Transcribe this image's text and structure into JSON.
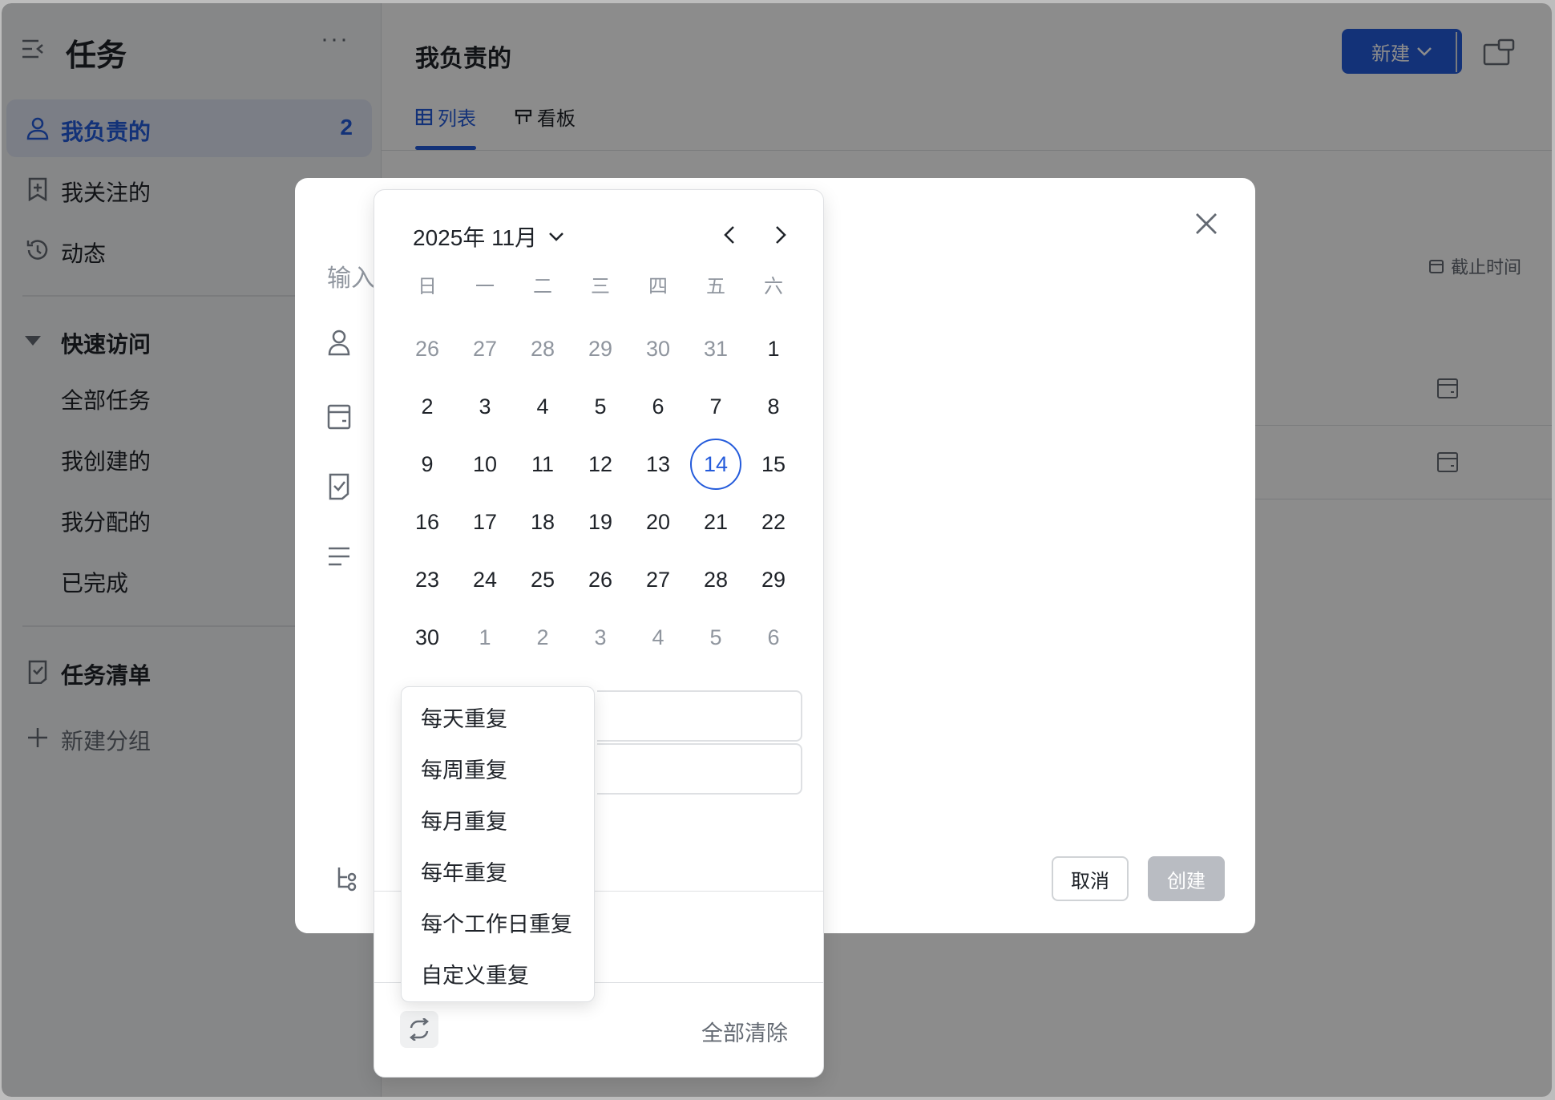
{
  "sidebar": {
    "title": "任务",
    "more": "···",
    "items": [
      {
        "label": "我负责的",
        "count": "2",
        "icon": "user-icon",
        "active": true
      },
      {
        "label": "我关注的",
        "icon": "bookmark-icon"
      },
      {
        "label": "动态",
        "icon": "history-icon"
      }
    ],
    "quick_access": {
      "label": "快速访问",
      "items": [
        "全部任务",
        "我创建的",
        "我分配的",
        "已完成"
      ]
    },
    "task_list": {
      "label": "任务清单",
      "icon": "checklist-icon"
    },
    "new_group": {
      "label": "新建分组",
      "icon": "plus-icon"
    }
  },
  "header": {
    "title": "我负责的",
    "new_button": "新建",
    "tabs": [
      {
        "label": "列表",
        "icon": "table-icon",
        "active": true
      },
      {
        "label": "看板",
        "icon": "kanban-icon"
      }
    ],
    "column_deadline": "截止时间"
  },
  "dialog": {
    "input_placeholder": "输入",
    "cancel": "取消",
    "create": "创建"
  },
  "datepicker": {
    "month_label": "2025年 11月",
    "weekdays": [
      "日",
      "一",
      "二",
      "三",
      "四",
      "五",
      "六"
    ],
    "weeks": [
      [
        {
          "d": "26",
          "o": true
        },
        {
          "d": "27",
          "o": true
        },
        {
          "d": "28",
          "o": true
        },
        {
          "d": "29",
          "o": true
        },
        {
          "d": "30",
          "o": true
        },
        {
          "d": "31",
          "o": true
        },
        {
          "d": "1"
        }
      ],
      [
        {
          "d": "2"
        },
        {
          "d": "3"
        },
        {
          "d": "4"
        },
        {
          "d": "5"
        },
        {
          "d": "6"
        },
        {
          "d": "7"
        },
        {
          "d": "8"
        }
      ],
      [
        {
          "d": "9"
        },
        {
          "d": "10"
        },
        {
          "d": "11"
        },
        {
          "d": "12"
        },
        {
          "d": "13"
        },
        {
          "d": "14",
          "today": true
        },
        {
          "d": "15"
        }
      ],
      [
        {
          "d": "16"
        },
        {
          "d": "17"
        },
        {
          "d": "18"
        },
        {
          "d": "19"
        },
        {
          "d": "20"
        },
        {
          "d": "21"
        },
        {
          "d": "22"
        }
      ],
      [
        {
          "d": "23"
        },
        {
          "d": "24"
        },
        {
          "d": "25"
        },
        {
          "d": "26"
        },
        {
          "d": "27"
        },
        {
          "d": "28"
        },
        {
          "d": "29"
        }
      ],
      [
        {
          "d": "30"
        },
        {
          "d": "1",
          "o": true
        },
        {
          "d": "2",
          "o": true
        },
        {
          "d": "3",
          "o": true
        },
        {
          "d": "4",
          "o": true
        },
        {
          "d": "5",
          "o": true
        },
        {
          "d": "6",
          "o": true
        }
      ]
    ],
    "clear_all": "全部清除"
  },
  "repeat_menu": {
    "options": [
      "每天重复",
      "每周重复",
      "每月重复",
      "每年重复",
      "每个工作日重复",
      "自定义重复"
    ]
  },
  "colors": {
    "accent": "#245bdb",
    "overlay": "rgba(0,0,0,0.45)",
    "muted_text": "#8f959e"
  }
}
